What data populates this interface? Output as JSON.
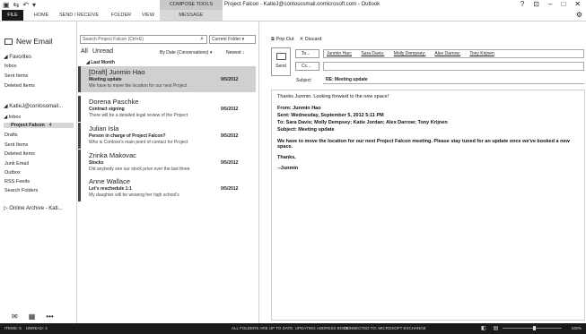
{
  "window": {
    "title": "Project Falcon - KatieJ@contososmail.onmicrosoft.com - Outlook",
    "context_tools": "COMPOSE TOOLS",
    "controls": [
      "?",
      "⊡",
      "–",
      "□",
      "✕"
    ]
  },
  "ribbon": {
    "tabs": [
      "FILE",
      "HOME",
      "SEND / RECEIVE",
      "FOLDER",
      "VIEW",
      "MESSAGE"
    ]
  },
  "nav": {
    "new_email": "New Email",
    "favorites": "◢ Favorites",
    "fav_items": [
      "Inbox",
      "Sent Items",
      "Deleted Items"
    ],
    "account": "◢ KatieJ@contosomail...",
    "inbox": "◢ Inbox",
    "selected_folder": "Project Falcon",
    "selected_count": "4",
    "folders": [
      "Drafts",
      "Sent Items",
      "Deleted Items",
      "Junk Email",
      "Outbox",
      "RSS Feeds",
      "Search Folders"
    ],
    "archive": "▷ Online Archive - Kati...",
    "bottom_icons": [
      "mail-icon",
      "calendar-icon",
      "more-icon"
    ]
  },
  "list": {
    "search_placeholder": "Search Project Falcon (Ctrl+E)",
    "scope": "Current Folder ▾",
    "filter_all": "All",
    "filter_unread": "Unread",
    "sort": "By Date (Conversations) ▾",
    "order": "Newest ↓",
    "group": "◢ Last Month",
    "messages": [
      {
        "from": "[Draft] Junmin Hao",
        "subject": "Meeting update",
        "preview": "We have to move the location for our next Project",
        "date": "9/5/2012"
      },
      {
        "from": "Dorena Paschke",
        "subject": "Contract signing",
        "preview": "There will be a detailed legal review of the Project",
        "date": "9/5/2012"
      },
      {
        "from": "Julian Isla",
        "subject": "Person in charge of Project Falcon?",
        "preview": "Who is Contoso's main point of contact for Project",
        "date": "9/5/2012"
      },
      {
        "from": "Zrinka Makovac",
        "subject": "Stocks",
        "preview": "Did anybody see our stock price over the last three",
        "date": "9/5/2012"
      },
      {
        "from": "Anne Wallace",
        "subject": "Let's reschedule 1:1",
        "preview": "My daughter will be wearing her high school's",
        "date": "9/5/2012"
      }
    ]
  },
  "reading": {
    "pop_out": "Pop Out",
    "discard": "Discard",
    "send": "Send",
    "to_label": "To...",
    "cc_label": "Cc...",
    "recipients": [
      "Junmin Hao;",
      "Sara Davis;",
      "Molly Dempsey;",
      "Alex Darrow;",
      "Tony Krijnen"
    ],
    "cc_value": "",
    "subject_label": "Subject",
    "subject_value": "RE: Meeting update",
    "body_greeting": "Thanks Junmin. Looking forward to the new space!",
    "hdr_from": "From: Junmin Hao",
    "hdr_sent": "Sent: Wednesday, September 5, 2012 5:11 PM",
    "hdr_to": "To: Sara Davis; Molly Dempsey; Katie Jordan; Alex Darrow; Tony Krijnen",
    "hdr_subject": "Subject: Meeting update",
    "body_text": "We have to move the location for our next Project Falcon meeting.  Please stay tuned for an update once we've booked a new space.",
    "thanks": "Thanks,",
    "sign": "--Junmin"
  },
  "status": {
    "items": "ITEMS: 5",
    "unread": "UNREAD: 4",
    "sync": "ALL FOLDERS ARE UP TO DATE.   UPDATING ADDRESS BOOK.",
    "connection": "CONNECTED TO: MICROSOFT EXCHANGE",
    "zoom": "100%"
  }
}
